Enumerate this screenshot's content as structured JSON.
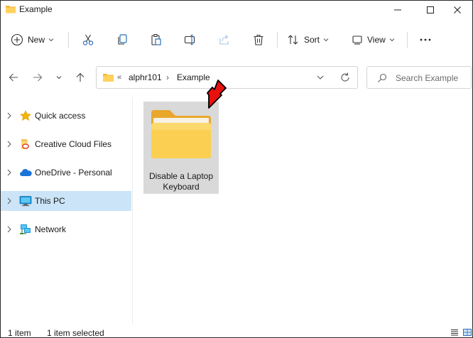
{
  "window": {
    "title": "Example"
  },
  "titlebar": {
    "icon": "folder-icon",
    "controls": [
      "minimize",
      "maximize",
      "close"
    ]
  },
  "toolbar": {
    "new_label": "New",
    "sort_label": "Sort",
    "view_label": "View",
    "icons": [
      "plus-circle-icon",
      "cut-icon",
      "copy-icon",
      "paste-icon",
      "rename-icon",
      "share-icon",
      "delete-icon",
      "sort-icon",
      "view-icon",
      "more-icon"
    ]
  },
  "address": {
    "overflow": "«",
    "crumbs": [
      "alphr101",
      "Example"
    ],
    "separator": "›"
  },
  "search": {
    "placeholder": "Search Example"
  },
  "sidebar": {
    "items": [
      {
        "label": "Quick access",
        "icon": "star-icon"
      },
      {
        "label": "Creative Cloud Files",
        "icon": "creative-cloud-icon"
      },
      {
        "label": "OneDrive - Personal",
        "icon": "onedrive-icon"
      },
      {
        "label": "This PC",
        "icon": "monitor-icon",
        "selected": true
      },
      {
        "label": "Network",
        "icon": "network-icon"
      }
    ]
  },
  "content": {
    "items": [
      {
        "name_line1": "Disable a Laptop",
        "name_line2": "Keyboard",
        "type": "folder"
      }
    ]
  },
  "status": {
    "count": "1 item",
    "selected": "1 item selected"
  },
  "colors": {
    "folder": "#f5c242",
    "selection": "#cce4f7",
    "tile_selected": "#d9d9d9",
    "annotation_arrow": "#e8110f"
  }
}
